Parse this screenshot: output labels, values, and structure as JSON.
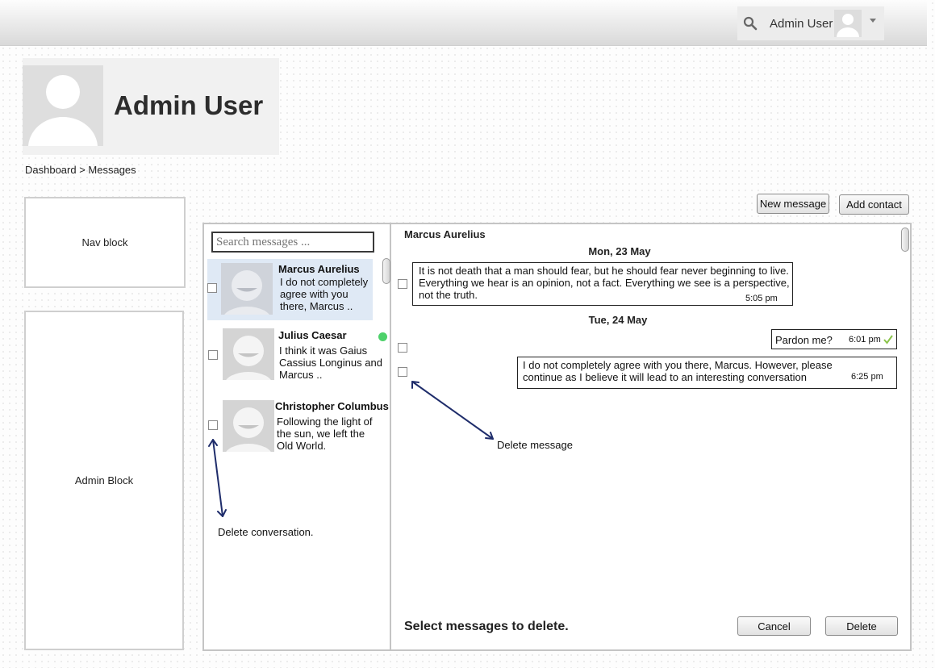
{
  "header": {
    "user_name": "Admin User",
    "profile_title": "Admin User"
  },
  "breadcrumb": "Dashboard > Messages",
  "blocks": {
    "nav": "Nav block",
    "admin": "Admin Block"
  },
  "toolbar": {
    "new_message": "New message",
    "add_contact": "Add contact"
  },
  "search": {
    "placeholder": "Search messages ..."
  },
  "conversations": [
    {
      "name": "Marcus Aurelius",
      "preview": "I do not completely agree with you there, Marcus ..",
      "active": true
    },
    {
      "name": "Julius Caesar",
      "preview": "I think it was Gaius Cassius Longinus and Marcus ..",
      "online": true
    },
    {
      "name": "Christopher Columbus",
      "preview": "Following the light of the sun, we left the Old World."
    }
  ],
  "annotations": {
    "delete_conversation": "Delete conversation.",
    "delete_message": "Delete message"
  },
  "chat": {
    "contact": "Marcus Aurelius",
    "days": [
      "Mon, 23 May",
      "Tue, 24 May"
    ],
    "messages": [
      {
        "text": "It is not death that a man should fear, but he should fear never beginning to live. Everything we hear is an opinion, not a fact. Everything we see is a perspective, not the truth.",
        "time": "5:05 pm",
        "direction": "incoming"
      },
      {
        "text": "Pardon me?",
        "time": "6:01 pm",
        "direction": "outgoing",
        "status": "read"
      },
      {
        "text": "I do not completely agree with you there, Marcus. However, please continue as I believe it will lead to an interesting conversation",
        "time": "6:25 pm",
        "direction": "outgoing"
      }
    ]
  },
  "footer": {
    "prompt": "Select messages to delete.",
    "cancel": "Cancel",
    "delete": "Delete"
  },
  "colors": {
    "active_conversation": "#dfe9f5",
    "online": "#4dd16a",
    "annotation_arrow": "#1f2d6b",
    "read_check": "#8bc34a"
  },
  "icons": {
    "search": "search-icon",
    "dropdown": "caret-down-icon",
    "read": "checkmark-icon"
  }
}
